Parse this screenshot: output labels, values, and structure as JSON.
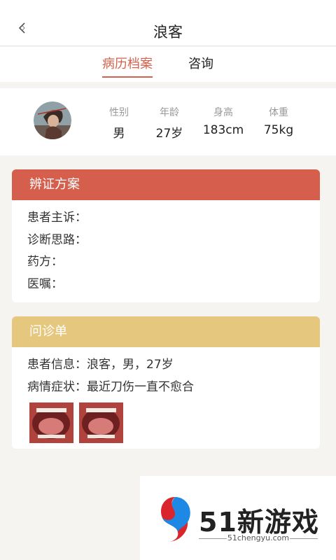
{
  "header": {
    "title": "浪客",
    "back_icon": "back-arrow-icon"
  },
  "tabs": [
    {
      "label": "病历档案",
      "active": true
    },
    {
      "label": "咨询",
      "active": false
    }
  ],
  "profile": {
    "avatar": "patient-avatar",
    "stats": [
      {
        "label": "性别",
        "value": "男"
      },
      {
        "label": "年龄",
        "value": "27岁"
      },
      {
        "label": "身高",
        "value": "183cm"
      },
      {
        "label": "体重",
        "value": "75kg"
      }
    ]
  },
  "diagnosis_card": {
    "title": "辨证方案",
    "header_color": "#d55e4d",
    "lines": [
      "患者主诉：",
      "诊断思路：",
      "药方：",
      "医嘱："
    ]
  },
  "consult_card": {
    "title": "问诊单",
    "header_color": "#e6c77e",
    "lines": [
      "患者信息：浪客，男，27岁",
      "病情症状：最近刀伤一直不愈合"
    ],
    "photos": [
      "mouth-photo-1",
      "mouth-photo-2"
    ]
  },
  "watermark": {
    "brand": "51新游戏",
    "url": "51chengyu.com"
  },
  "colors": {
    "accent": "#d4614b",
    "background": "#f5f4f1"
  }
}
